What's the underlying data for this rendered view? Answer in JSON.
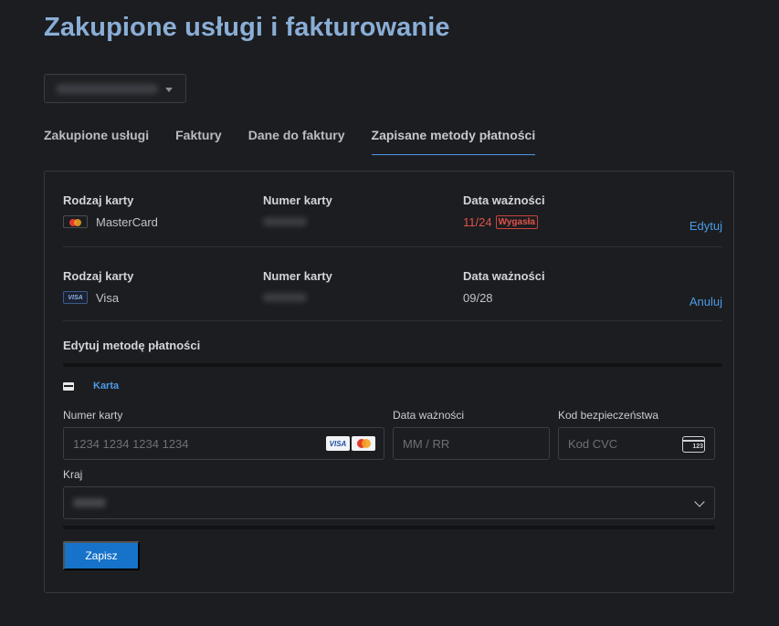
{
  "page": {
    "title": "Zakupione usługi i fakturowanie"
  },
  "account_select": {
    "value": ""
  },
  "tabs": [
    {
      "label": "Zakupione usługi"
    },
    {
      "label": "Faktury"
    },
    {
      "label": "Dane do faktury"
    },
    {
      "label": "Zapisane metody płatności",
      "active": true
    }
  ],
  "saved_methods": {
    "col_card_type": "Rodzaj karty",
    "col_card_number": "Numer karty",
    "col_expiry": "Data ważności",
    "items": [
      {
        "brand": "MasterCard",
        "brand_icon": "mastercard-icon",
        "number": "",
        "expiry": "11/24",
        "status": "Wygasła",
        "action": "Edytuj"
      },
      {
        "brand": "Visa",
        "brand_icon": "visa-icon",
        "number": "",
        "expiry": "09/28",
        "status": "",
        "action": "Anuluj"
      }
    ]
  },
  "edit_form": {
    "title": "Edytuj metodę płatności",
    "method_tab": "Karta",
    "card_number_label": "Numer karty",
    "card_number_placeholder": "1234 1234 1234 1234",
    "expiry_label": "Data ważności",
    "expiry_placeholder": "MM / RR",
    "cvc_label": "Kod bezpieczeństwa",
    "cvc_placeholder": "Kod CVC",
    "cvc_icon_text": "123",
    "country_label": "Kraj",
    "country_value": "",
    "save_label": "Zapisz",
    "accepted_brands": [
      "VISA",
      "MasterCard"
    ]
  },
  "colors": {
    "accent": "#4a9be6",
    "title": "#8aaed6",
    "danger": "#e0524b",
    "button": "#1673c9"
  }
}
